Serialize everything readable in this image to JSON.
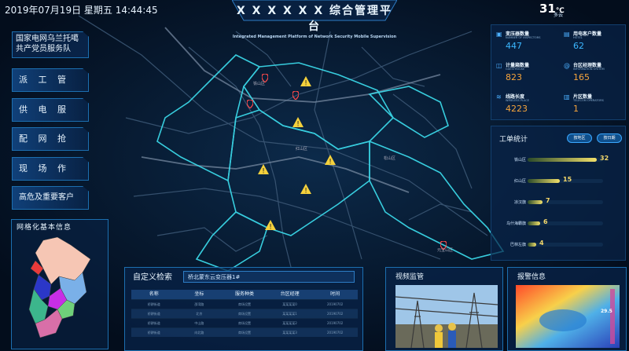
{
  "header": {
    "datetime": "2019年07月19日 星期五 14:44:45",
    "title": "X X X X X X 综合管理平台",
    "subtitle": "Integrated Management Platform of Network Security Mobile Supervision",
    "temperature": "31",
    "temp_unit": "℃",
    "weather": "多云"
  },
  "sidebar": {
    "org_name_line1": "国家电网乌兰托噶",
    "org_name_line2": "共产党员服务队",
    "menu": [
      "派 工 管 理",
      "供 电 服 务",
      "配 网 抢 修",
      "现 场 作 业",
      "高危及重要客户"
    ],
    "grid_title": "网格化基本信息"
  },
  "stats": [
    {
      "icon": "transformer-icon",
      "label": "变压器数量",
      "en": "NUMBER OF INSPECTORS",
      "value": "447",
      "color": "#3bb7ff"
    },
    {
      "icon": "customer-icon",
      "label": "用电客户数量",
      "en": "HOTEL",
      "value": "62",
      "color": "#3bb7ff"
    },
    {
      "icon": "meter-icon",
      "label": "计量箱数量",
      "en": "GUESTHOUSE",
      "value": "823",
      "color": "#f5a43c"
    },
    {
      "icon": "manager-icon",
      "label": "台区经理数量",
      "en": "INFORMATION SYSTEM",
      "value": "165",
      "color": "#f5a43c"
    },
    {
      "icon": "line-icon",
      "label": "线路长度",
      "en": "WIRELESS PLACE",
      "value": "4223",
      "color": "#f5a43c"
    },
    {
      "icon": "area-icon",
      "label": "片区数量",
      "en": "TELECOM OPERATORS",
      "value": "1",
      "color": "#f5a43c"
    }
  ],
  "work_orders": {
    "title": "工单统计",
    "btn1": "按地区",
    "btn2": "按日期",
    "rows": [
      {
        "label": "铁山区",
        "value": 32
      },
      {
        "label": "红山区",
        "value": 15
      },
      {
        "label": "凉汉旗",
        "value": 7
      },
      {
        "label": "乌什海霸旗",
        "value": 6
      },
      {
        "label": "巴林左旗",
        "value": 4
      }
    ],
    "max": 35
  },
  "search": {
    "title": "自定义检索",
    "value": "桥北蒙东云变压器1#",
    "columns": [
      "名称",
      "坐标",
      "服务种类",
      "台区经理",
      "时间"
    ],
    "rows": [
      [
        "桥耕街道",
        "邵湾路",
        "商场设置",
        "某某某某0",
        "20190702"
      ],
      [
        "桥耕街道",
        "北京",
        "商场设置",
        "某某某某1",
        "20190702"
      ],
      [
        "桥耕街道",
        "中山路",
        "商场设置",
        "某某某某2",
        "20190702"
      ],
      [
        "桥耕街道",
        "向北路",
        "商场设置",
        "某某某某3",
        "20190702"
      ]
    ]
  },
  "video": {
    "title": "视频监管"
  },
  "alarm": {
    "title": "报警信息",
    "temp_value": "29.5"
  },
  "map": {
    "labels": [
      "铁山区",
      "红山区",
      "松山区",
      "元宝山区"
    ]
  }
}
